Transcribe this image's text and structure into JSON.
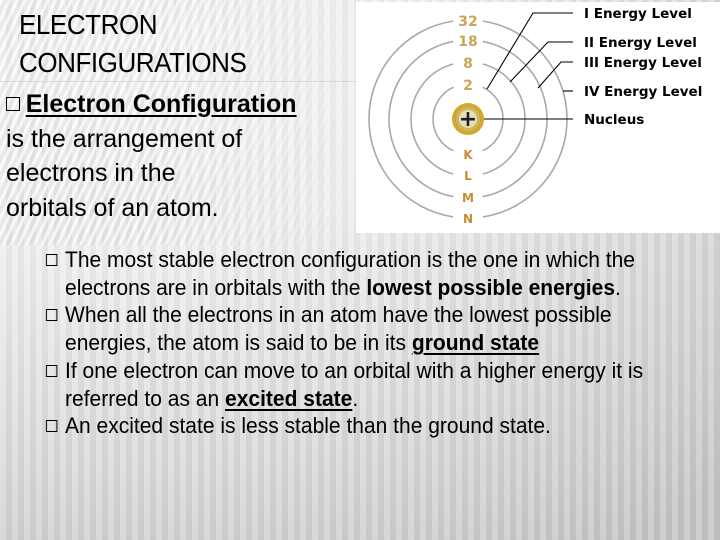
{
  "slide": {
    "title_lines": [
      "ELECTRON",
      "CONFIGURATIONS"
    ],
    "definition": {
      "term": "Electron Configuration",
      "rest_lines": [
        "is the arrangement of",
        "electrons in the",
        "orbitals of an atom."
      ]
    },
    "bullets": [
      {
        "parts": [
          {
            "text": "The most stable electron configuration is the one in which the electrons are in orbitals with the ",
            "style": "normal"
          },
          {
            "text": "lowest possible energies",
            "style": "bold"
          },
          {
            "text": ".",
            "style": "normal"
          }
        ]
      },
      {
        "parts": [
          {
            "text": " When all the electrons in an atom have the lowest possible energies, the atom is said to be in its ",
            "style": "normal"
          },
          {
            "text": "ground state",
            "style": "bold-underline"
          }
        ]
      },
      {
        "parts": [
          {
            "text": "If one electron can move to an orbital with a higher energy it is referred to as an ",
            "style": "normal"
          },
          {
            "text": "excited state",
            "style": "bold-underline"
          },
          {
            "text": ".",
            "style": "normal"
          }
        ]
      },
      {
        "parts": [
          {
            "text": "An excited state is less stable than the ground state.",
            "style": "normal"
          }
        ]
      }
    ]
  },
  "diagram": {
    "shells": [
      {
        "letter": "K",
        "capacity": "2",
        "label": "I Energy Level"
      },
      {
        "letter": "L",
        "capacity": "8",
        "label": "II Energy Level"
      },
      {
        "letter": "M",
        "capacity": "18",
        "label": "III Energy Level"
      },
      {
        "letter": "N",
        "capacity": "32",
        "label": "IV Energy Level"
      }
    ],
    "nucleus_label": "Nucleus",
    "nucleus_symbol": "+",
    "colors": {
      "ring": "#a9a9a9",
      "capacity_text": "#c9a55a",
      "letter_text": "#c98a2e",
      "nucleus_outer": "#d4a72c",
      "nucleus_inner": "#e8e0a8",
      "leader": "#000000"
    }
  }
}
